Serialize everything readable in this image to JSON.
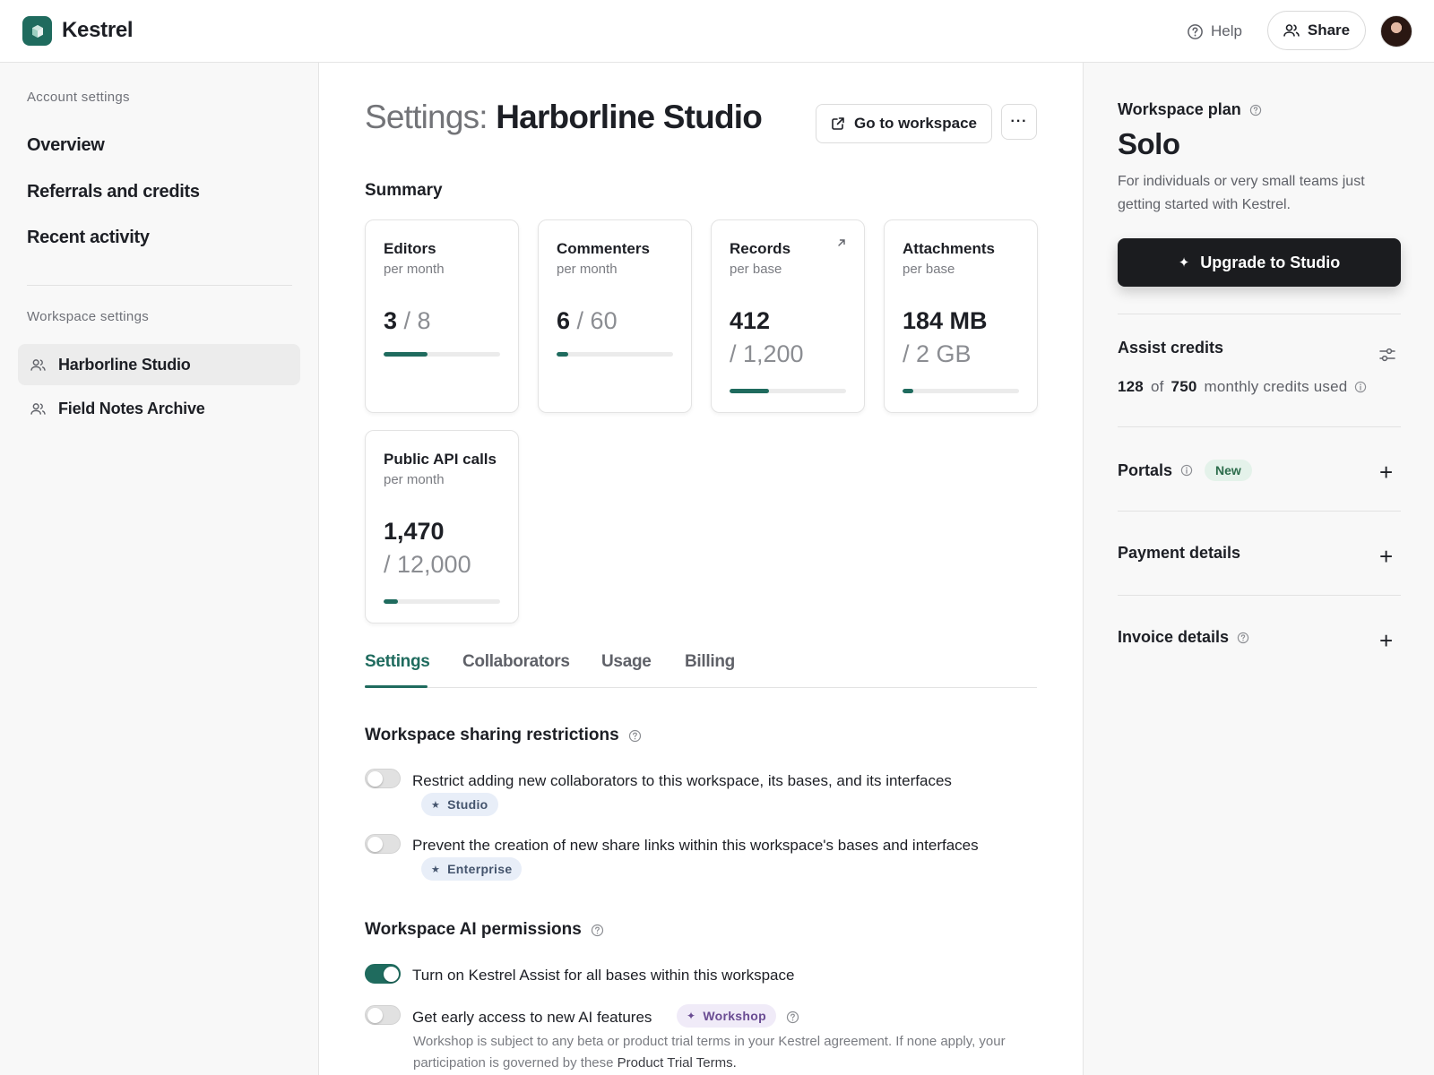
{
  "app": {
    "name": "Kestrel"
  },
  "header": {
    "help_label": "Help",
    "share_label": "Share"
  },
  "sidebar": {
    "account_section": "Account settings",
    "account_links": [
      "Overview",
      "Referrals and credits",
      "Recent activity"
    ],
    "workspace_section": "Workspace settings",
    "workspaces": [
      {
        "label": "Harborline Studio",
        "active": true
      },
      {
        "label": "Field Notes Archive",
        "active": false
      }
    ]
  },
  "main": {
    "title_prefix": "Settings:",
    "title_name": "Harborline Studio",
    "goto_label": "Go to workspace",
    "more_label": "···",
    "summary_heading": "Summary",
    "cards": [
      {
        "title": "Editors",
        "sub": "per month",
        "value": "3",
        "limit": "/ 8",
        "progress": 0.375
      },
      {
        "title": "Commenters",
        "sub": "per month",
        "value": "6",
        "limit": "/ 60",
        "progress": 0.1
      },
      {
        "title": "Records",
        "sub": "per base",
        "value": "412",
        "limit": "/ 1,200",
        "progress": 0.34
      },
      {
        "title": "Attachments",
        "sub": "per base",
        "value": "184 MB",
        "limit": "/ 2 GB",
        "progress": 0.09
      },
      {
        "title": "Public API calls",
        "sub": "per month",
        "value": "1,470",
        "limit": "/ 12,000",
        "progress": 0.12
      }
    ],
    "tabs": [
      "Settings",
      "Collaborators",
      "Usage",
      "Billing"
    ],
    "active_tab": "Settings",
    "sharing": {
      "heading": "Workspace sharing restrictions",
      "options": [
        {
          "label": "Restrict adding new collaborators to this workspace, its bases, and its interfaces",
          "badge": "Studio",
          "enabled": false
        },
        {
          "label": "Prevent the creation of new share links within this workspace's bases and interfaces",
          "badge": "Enterprise",
          "enabled": false
        }
      ]
    },
    "ai": {
      "heading": "Workspace AI permissions",
      "options": [
        {
          "label": "Turn on Kestrel Assist for all bases within this workspace",
          "enabled": true
        },
        {
          "label": "Get early access to new AI features",
          "badge": "Workshop",
          "enabled": false
        }
      ],
      "note": "Workshop is subject to any beta or product trial terms in your Kestrel agreement. If none apply, your participation is governed by these",
      "note_link": "Product Trial Terms."
    }
  },
  "plan": {
    "label": "Workspace plan",
    "name": "Solo",
    "description": "For individuals or very small teams just getting started with Kestrel.",
    "upgrade_label": "Upgrade to Studio",
    "credits_heading": "Assist credits",
    "credits_used": "128",
    "credits_of": "of",
    "credits_total": "750",
    "credits_suffix": "monthly credits used",
    "portals_label": "Portals",
    "portals_badge": "New",
    "payment_label": "Payment details",
    "invoice_label": "Invoice details"
  },
  "colors": {
    "accent": "#1f6b5e",
    "upgrade_bg": "#1b1c1f"
  }
}
